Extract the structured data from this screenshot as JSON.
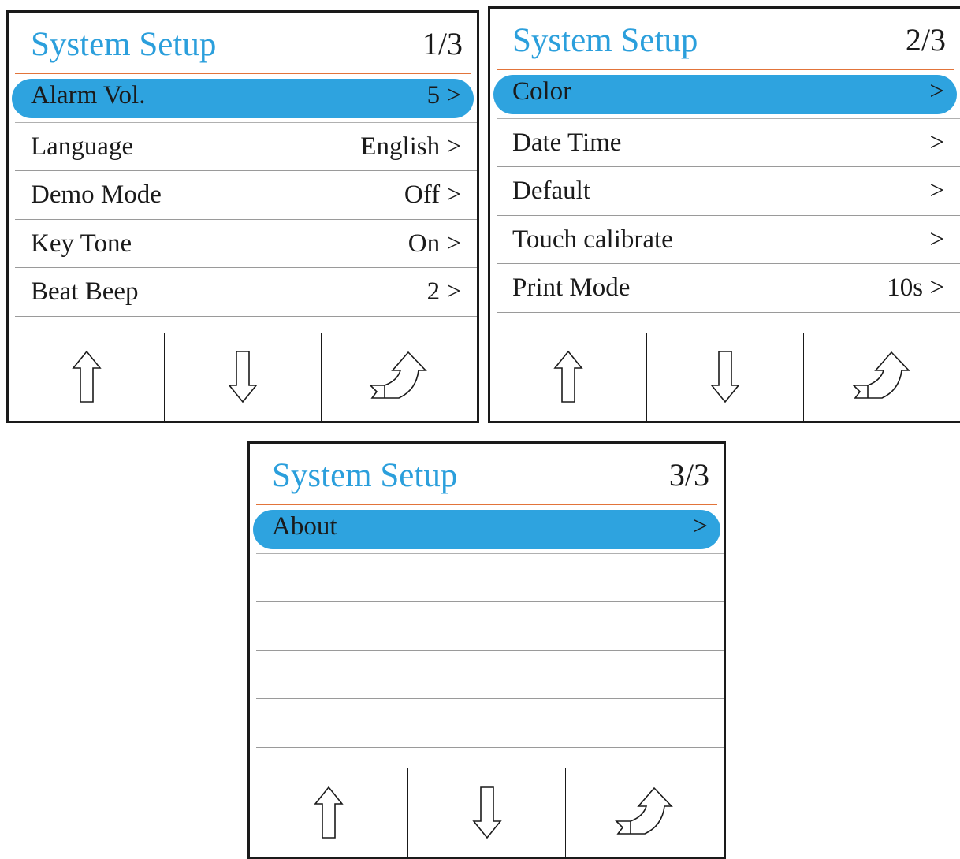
{
  "screens": [
    {
      "title": "System Setup",
      "page": "1/3",
      "items": [
        {
          "label": "Alarm Vol.",
          "value": "5 >"
        },
        {
          "label": "Language",
          "value": "English >"
        },
        {
          "label": "Demo Mode",
          "value": "Off >"
        },
        {
          "label": "Key Tone",
          "value": "On >"
        },
        {
          "label": "Beat Beep",
          "value": "2 >"
        }
      ],
      "selected_index": 0
    },
    {
      "title": "System Setup",
      "page": "2/3",
      "items": [
        {
          "label": "Color",
          "value": ">"
        },
        {
          "label": "Date Time",
          "value": ">"
        },
        {
          "label": "Default",
          "value": ">"
        },
        {
          "label": "Touch calibrate",
          "value": ">"
        },
        {
          "label": "Print Mode",
          "value": "10s >"
        }
      ],
      "selected_index": 0
    },
    {
      "title": "System Setup",
      "page": "3/3",
      "items": [
        {
          "label": "About",
          "value": ">"
        },
        {
          "label": "",
          "value": ""
        },
        {
          "label": "",
          "value": ""
        },
        {
          "label": "",
          "value": ""
        },
        {
          "label": "",
          "value": ""
        }
      ],
      "selected_index": 0
    }
  ],
  "footer_icons": [
    "arrow-up-icon",
    "arrow-down-icon",
    "return-icon"
  ],
  "colors": {
    "title": "#2b9fdc",
    "selection": "#2ea3df",
    "header_rule": "#e2743a",
    "border": "#1a1a1a"
  }
}
